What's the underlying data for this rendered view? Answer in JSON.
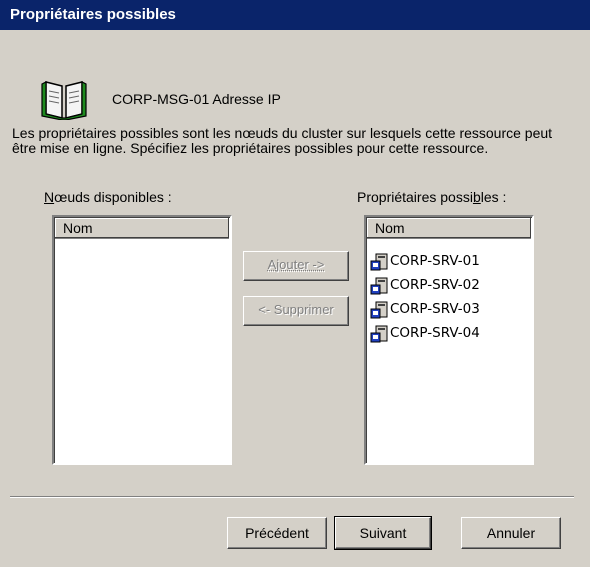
{
  "window": {
    "title": "Propriétaires possibles"
  },
  "resource": {
    "name": "CORP-MSG-01 Adresse IP",
    "icon": "book-icon"
  },
  "description": "Les propriétaires possibles sont les nœuds du cluster sur lesquels cette ressource peut être mise en ligne. Spécifiez les propriétaires possibles pour cette ressource.",
  "available": {
    "label_mnemonic": "N",
    "label_rest": "œuds disponibles :",
    "column": "Nom",
    "items": []
  },
  "owners": {
    "label_pre": "Propriétaires possi",
    "label_mnemonic": "b",
    "label_post": "les :",
    "column": "Nom",
    "items": [
      "CORP-SRV-01",
      "CORP-SRV-02",
      "CORP-SRV-03",
      "CORP-SRV-04"
    ],
    "item_icon": "server-icon"
  },
  "actions": {
    "add_label": "Ajouter ->",
    "remove_label": "<- Supprimer"
  },
  "footer": {
    "back_label": "Précédent",
    "next_label": "Suivant",
    "cancel_label": "Annuler"
  },
  "colors": {
    "titlebar": "#0a246a",
    "face": "#d4d0c8",
    "book": "#1e8a1e"
  }
}
